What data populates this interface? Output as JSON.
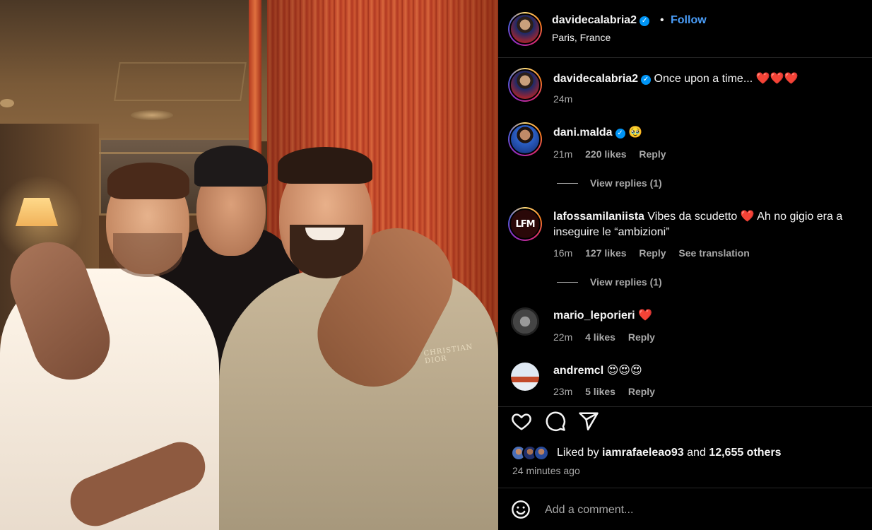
{
  "post": {
    "username": "davidecalabria2",
    "follow_label": "Follow",
    "location": "Paris, France",
    "caption": "Once upon a time...",
    "caption_hearts": "❤️❤️❤️",
    "caption_time": "24m",
    "image_text": "CHRISTIAN DIOR"
  },
  "comments": [
    {
      "username": "dani.malda",
      "verified": true,
      "text": "🥹",
      "time": "21m",
      "likes": "220 likes",
      "reply": "Reply",
      "view_replies": "View replies (1)"
    },
    {
      "username": "lafossamilaniista",
      "verified": false,
      "text": "Vibes da scudetto ❤️ Ah no gigio era a inseguire le “ambizioni”",
      "avatar_text": "LFM",
      "time": "16m",
      "likes": "127 likes",
      "reply": "Reply",
      "translate": "See translation",
      "view_replies": "View replies (1)"
    },
    {
      "username": "mario_leporieri",
      "verified": false,
      "text": "❤️",
      "time": "22m",
      "likes": "4 likes",
      "reply": "Reply"
    },
    {
      "username": "andremcl",
      "verified": false,
      "text": "😍😍😍",
      "time": "23m",
      "likes": "5 likes",
      "reply": "Reply"
    }
  ],
  "likes": {
    "prefix": "Liked by",
    "user": "iamrafaeleao93",
    "joiner": "and",
    "others": "12,655 others",
    "time_ago": "24 minutes ago"
  },
  "composer": {
    "placeholder": "Add a comment..."
  },
  "icons": [
    "verified-badge-icon",
    "heart-icon",
    "comment-icon",
    "share-icon",
    "emoji-icon"
  ],
  "colors": {
    "accent": "#0095f6",
    "follow": "#4a9df8",
    "heart": "#ff3040",
    "muted": "#a8a8a8",
    "bg": "#000000"
  }
}
